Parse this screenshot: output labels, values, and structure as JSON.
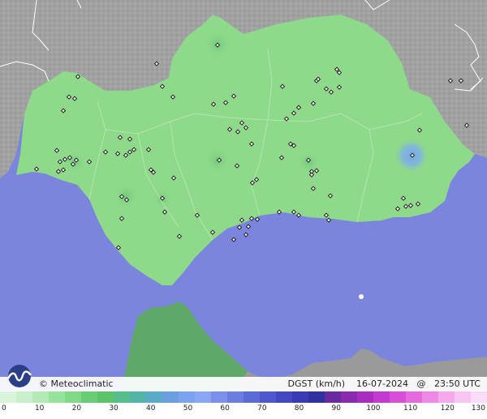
{
  "credit": {
    "label": "© Meteoclimatic"
  },
  "info": {
    "variable": "DGST (km/h)",
    "date": "16-07-2024",
    "at": "@",
    "time": "23:50 UTC"
  },
  "legend": {
    "ticks": [
      "0",
      "10",
      "20",
      "30",
      "40",
      "50",
      "60",
      "70",
      "80",
      "90",
      "100",
      "110",
      "120",
      "130"
    ],
    "min": 0,
    "max": 130,
    "colors": [
      "#d8f5da",
      "#c8f0ca",
      "#b2ebb4",
      "#98e39c",
      "#7fd986",
      "#6acc74",
      "#5cc36b",
      "#56be8b",
      "#52b5a8",
      "#5aaac8",
      "#6a9fe0",
      "#7aa2ee",
      "#8aa8f2",
      "#7a90ea",
      "#6a7ee0",
      "#5a6ad6",
      "#4e58cc",
      "#4248c0",
      "#3a3ab2",
      "#3030a0",
      "#6a2aa0",
      "#8a2ab0",
      "#a82cc0",
      "#c23ad0",
      "#d84ed8",
      "#e46ade",
      "#ee88e6",
      "#f4a8ee",
      "#f8c6f4",
      "#fbdcf8"
    ]
  },
  "colors": {
    "sea": "#7b85dd",
    "land_outside": "#9a9a9a",
    "region_fill": "#8fd98a",
    "station_marker": "#111111",
    "hotspot": "#7ea6e4"
  },
  "stations": {
    "count_shown": 95
  }
}
